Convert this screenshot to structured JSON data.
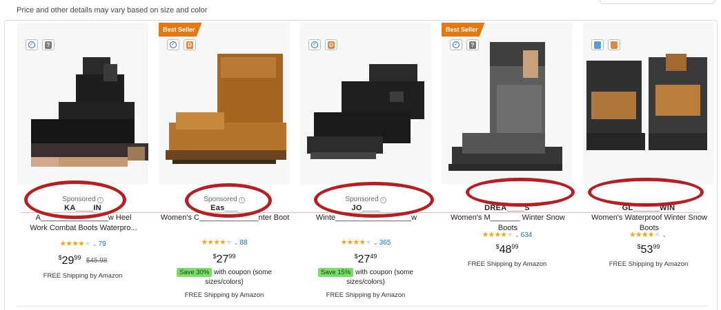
{
  "notice": "Price and other details may vary based on size and color",
  "products": [
    {
      "sponsored": "Sponsored",
      "brand": "KA____IN",
      "title_line1": "A________________w Heel",
      "title_line2": "Work Combat Boots Waterpro...",
      "rating_count": "79",
      "price_symbol": "$",
      "price_whole": "29",
      "price_fraction": "99",
      "price_was": "$45.98",
      "shipping": "FREE Shipping by Amazon"
    },
    {
      "badge": "Best Seller",
      "sponsored": "Sponsored",
      "brand": "Eas___",
      "title_line1": "Women's C______________nter Boot",
      "title_line2": "",
      "rating_count": "88",
      "price_symbol": "$",
      "price_whole": "27",
      "price_fraction": "99",
      "save_badge": "Save 30%",
      "coupon_text": "with coupon (some sizes/colors)",
      "shipping": "FREE Shipping by Amazon"
    },
    {
      "sponsored": "Sponsored",
      "brand": "JO____",
      "title_line1": "Winte__________________w",
      "title_line2": "",
      "rating_count": "365",
      "price_symbol": "$",
      "price_whole": "27",
      "price_fraction": "49",
      "save_badge": "Save 15%",
      "coupon_text": "with coupon (some sizes/colors)",
      "shipping": "FREE Shipping by Amazon"
    },
    {
      "badge": "Best Seller",
      "sponsored": "",
      "brand": "DREA____S",
      "title_line1": "Women's M_______ Winter Snow",
      "title_line2": "Boots",
      "rating_count": "634",
      "price_symbol": "$",
      "price_whole": "48",
      "price_fraction": "99",
      "shipping": "FREE Shipping by Amazon"
    },
    {
      "sponsored": "",
      "brand": "GL______WIN",
      "title_line1": "Women's Waterproof Winter Snow",
      "title_line2": "Boots",
      "rating_count": "",
      "price_symbol": "$",
      "price_whole": "53",
      "price_fraction": "99",
      "shipping": "FREE Shipping by Amazon"
    }
  ],
  "colors": {
    "badge": "#e47911",
    "star": "#f0a71c",
    "link": "#1a6fa8",
    "save_badge": "#7fda69",
    "annotation_oval": "#b51f24"
  },
  "icons": [
    "compare-check-icon",
    "quick-view-icon",
    "info-icon",
    "star-icon",
    "chevron-down-icon"
  ]
}
